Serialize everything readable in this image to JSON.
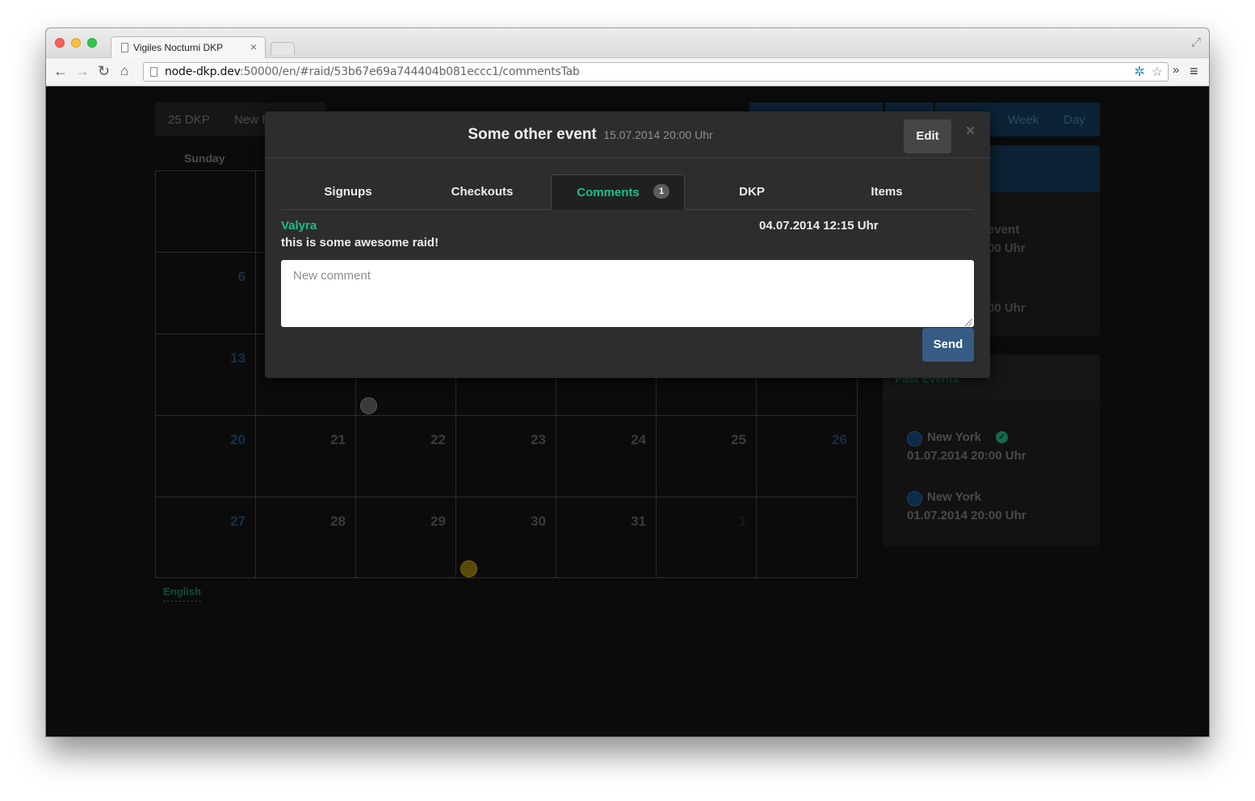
{
  "browser": {
    "tab_title": "Vigiles Nocturni DKP",
    "url_host": "node-dkp.dev",
    "url_rest": ":50000/en/#raid/53b67e69a744404b081eccc1/commentsTab"
  },
  "topnav": {
    "dkp": "25 DKP",
    "new_event": "New E"
  },
  "view_buttons": [
    "Week",
    "Day"
  ],
  "calendar": {
    "day_header": "Sunday",
    "rows": [
      [
        "",
        "",
        "",
        "",
        "",
        "",
        ""
      ],
      [
        "6",
        "",
        "",
        "",
        "",
        "",
        ""
      ],
      [
        "13",
        "",
        "",
        "",
        "",
        "",
        ""
      ],
      [
        "20",
        "21",
        "22",
        "23",
        "24",
        "25",
        "26"
      ],
      [
        "27",
        "28",
        "29",
        "30",
        "31",
        "1",
        ""
      ]
    ]
  },
  "language": "English",
  "upcoming": {
    "event_frag": "event",
    "time1": "00 Uhr",
    "time2": "00 Uhr"
  },
  "past_events": {
    "title": "Past Events",
    "items": [
      {
        "name": "New York",
        "date": "01.07.2014 20:00 Uhr",
        "checked": true
      },
      {
        "name": "New York",
        "date": "01.07.2014 20:00 Uhr",
        "checked": false
      }
    ]
  },
  "modal": {
    "title": "Some other event",
    "date": "15.07.2014 20:00 Uhr",
    "edit_label": "Edit",
    "close_label": "×",
    "tabs": [
      {
        "label": "Signups"
      },
      {
        "label": "Checkouts"
      },
      {
        "label": "Comments",
        "count": "1"
      },
      {
        "label": "DKP"
      },
      {
        "label": "Items"
      }
    ],
    "comment": {
      "author": "Valyra",
      "time": "04.07.2014 12:15 Uhr",
      "text": "this is some awesome raid!"
    },
    "input_placeholder": "New comment",
    "input_value": "",
    "send_label": "Send"
  },
  "colors": {
    "accent": "#17bf8c",
    "primary": "#365b85"
  }
}
